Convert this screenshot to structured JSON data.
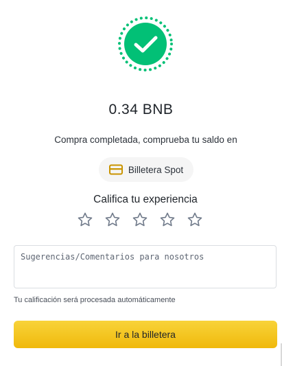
{
  "amount": "0.34 BNB",
  "message": "Compra completada, comprueba tu saldo en",
  "wallet": {
    "label": "Billetera Spot",
    "icon": "wallet-icon"
  },
  "rating": {
    "title": "Califica tu experiencia",
    "max": 5,
    "selected": 0
  },
  "feedback": {
    "placeholder": "Sugerencias/Comentarios para nosotros",
    "value": ""
  },
  "note": "Tu calificación será procesada automáticamente",
  "cta": {
    "label": "Ir a la billetera"
  },
  "colors": {
    "success": "#02c076",
    "accent": "#f0b90b",
    "wallet_icon": "#c99400",
    "star_outline": "#707a8a"
  }
}
